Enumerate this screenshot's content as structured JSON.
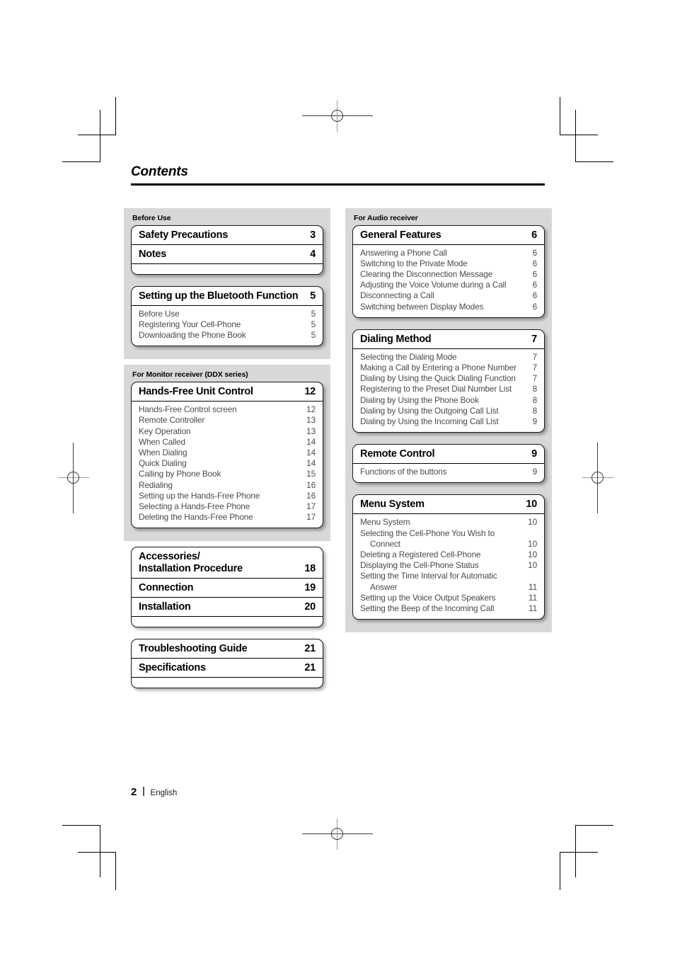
{
  "page_title": "Contents",
  "footer": {
    "page_number": "2",
    "language": "English"
  },
  "left_column": [
    {
      "shaded": true,
      "label": "Before Use",
      "cards": [
        {
          "majors": [
            {
              "title": "Safety Precautions",
              "page": "3"
            },
            {
              "title": "Notes",
              "page": "4"
            }
          ],
          "subs": [],
          "tail": true
        },
        {
          "majors": [
            {
              "title": "Setting up the Bluetooth Function",
              "page": "5"
            }
          ],
          "subs": [
            {
              "title": "Before Use",
              "page": "5"
            },
            {
              "title": "Registering Your Cell-Phone",
              "page": "5"
            },
            {
              "title": "Downloading the Phone Book",
              "page": "5"
            }
          ],
          "tail": false
        }
      ]
    },
    {
      "shaded": true,
      "label": "For Monitor receiver (DDX series)",
      "cards": [
        {
          "majors": [
            {
              "title": "Hands-Free Unit Control",
              "page": "12"
            }
          ],
          "subs": [
            {
              "title": "Hands-Free Control screen",
              "page": "12"
            },
            {
              "title": "Remote Controller",
              "page": "13"
            },
            {
              "title": "Key Operation",
              "page": "13"
            },
            {
              "title": "When Called",
              "page": "14"
            },
            {
              "title": "When Dialing",
              "page": "14"
            },
            {
              "title": "Quick Dialing",
              "page": "14"
            },
            {
              "title": "Calling by Phone Book",
              "page": "15"
            },
            {
              "title": "Redialing",
              "page": "16"
            },
            {
              "title": "Setting up the Hands-Free Phone",
              "page": "16"
            },
            {
              "title": "Selecting a Hands-Free Phone",
              "page": "17"
            },
            {
              "title": "Deleting the Hands-Free Phone",
              "page": "17"
            }
          ],
          "tail": false
        }
      ]
    },
    {
      "shaded": false,
      "label": "",
      "cards": [
        {
          "majors": [
            {
              "title": "Accessories/\nInstallation Procedure",
              "page": "18"
            },
            {
              "title": "Connection",
              "page": "19"
            },
            {
              "title": "Installation",
              "page": "20"
            }
          ],
          "subs": [],
          "tail": true
        },
        {
          "majors": [
            {
              "title": "Troubleshooting Guide",
              "page": "21"
            },
            {
              "title": "Specifications",
              "page": "21"
            }
          ],
          "subs": [],
          "tail": true
        }
      ]
    }
  ],
  "right_column": [
    {
      "shaded": true,
      "label": "For Audio receiver",
      "cards": [
        {
          "majors": [
            {
              "title": "General Features",
              "page": "6"
            }
          ],
          "subs": [
            {
              "title": "Answering a Phone Call",
              "page": "6"
            },
            {
              "title": "Switching to the Private Mode",
              "page": "6"
            },
            {
              "title": "Clearing the Disconnection Message",
              "page": "6"
            },
            {
              "title": "Adjusting the Voice Volume during a Call",
              "page": "6"
            },
            {
              "title": "Disconnecting a Call",
              "page": "6"
            },
            {
              "title": "Switching between Display Modes",
              "page": "6"
            }
          ],
          "tail": false
        },
        {
          "majors": [
            {
              "title": "Dialing Method",
              "page": "7"
            }
          ],
          "subs": [
            {
              "title": "Selecting the Dialing Mode",
              "page": "7"
            },
            {
              "title": "Making a Call by Entering a Phone Number",
              "page": "7"
            },
            {
              "title": "Dialing by Using the Quick Dialing Function",
              "page": "7"
            },
            {
              "title": "Registering to the Preset Dial Number List",
              "page": "8"
            },
            {
              "title": "Dialing by Using the Phone Book",
              "page": "8"
            },
            {
              "title": "Dialing by Using the Outgoing Call List",
              "page": "8"
            },
            {
              "title": "Dialing by Using the Incoming Call List",
              "page": "9"
            }
          ],
          "tail": false
        },
        {
          "majors": [
            {
              "title": "Remote Control",
              "page": "9"
            }
          ],
          "subs": [
            {
              "title": "Functions of the buttons",
              "page": "9"
            }
          ],
          "tail": false
        },
        {
          "majors": [
            {
              "title": "Menu System",
              "page": "10"
            }
          ],
          "subs": [
            {
              "title": "Menu System",
              "page": "10"
            },
            {
              "title": "Selecting the Cell-Phone You Wish to",
              "cont": "Connect",
              "page": "10"
            },
            {
              "title": "Deleting a Registered Cell-Phone",
              "page": "10"
            },
            {
              "title": "Displaying the Cell-Phone Status",
              "page": "10"
            },
            {
              "title": "Setting the Time Interval for Automatic",
              "cont": "Answer",
              "page": "11"
            },
            {
              "title": "Setting up the Voice Output Speakers",
              "page": "11"
            },
            {
              "title": "Setting the Beep of the Incoming Call",
              "page": "11"
            }
          ],
          "tail": false
        }
      ]
    }
  ]
}
